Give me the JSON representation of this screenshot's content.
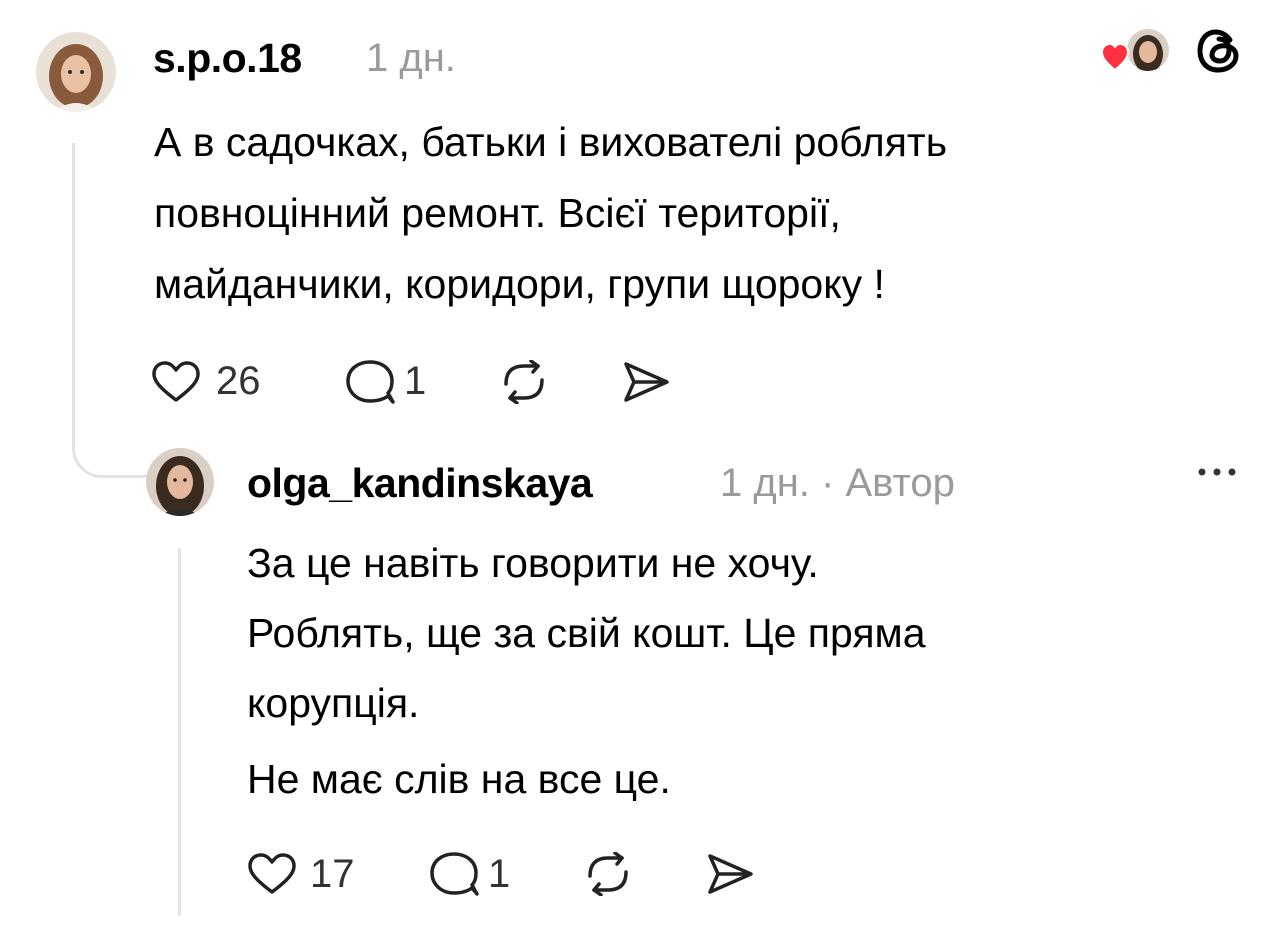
{
  "post": {
    "username": "s.p.o.18",
    "time": "1 дн.",
    "lines": [
      "А в садочках, батьки і вихователі роблять",
      "повноцінний ремонт. Всієї території,",
      "майданчики, коридори, групи щороку !"
    ],
    "likes": "26",
    "replies": "1"
  },
  "reply": {
    "username": "olga_kandinskaya",
    "time": "1 дн.",
    "separator": "·",
    "author_badge": "Автор",
    "lines": [
      "За це навіть говорити не хочу.",
      "Роблять, ще за свій кошт. Це пряма",
      "корупція.",
      "Не має слів на все це."
    ],
    "likes": "17",
    "replies": "1"
  },
  "icons": {
    "like": "heart-outline-icon",
    "reply": "speech-bubble-icon",
    "repost": "repost-arrows-icon",
    "share": "send-icon",
    "more": "ellipsis-icon",
    "app_logo": "threads-logo-icon",
    "liked_by_author": "red-heart-icon"
  },
  "colors": {
    "text": "#000000",
    "muted": "#9a9a9a",
    "thread_line": "#e3e3e3",
    "heart_red": "#ff3040"
  }
}
